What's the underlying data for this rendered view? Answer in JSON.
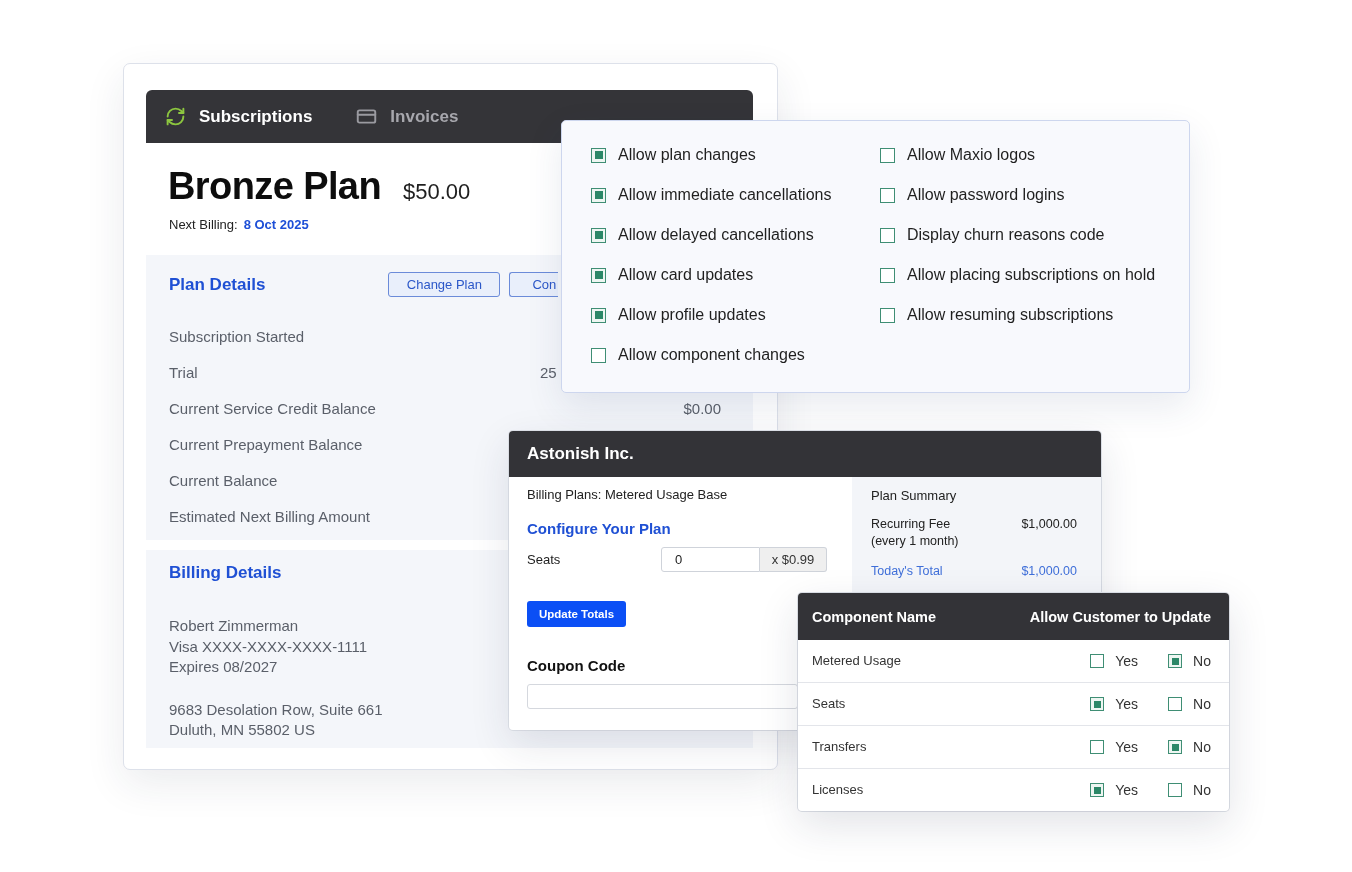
{
  "subscription_card": {
    "tabs": [
      {
        "label": "Subscriptions",
        "selected": true
      },
      {
        "label": "Invoices",
        "selected": false
      }
    ],
    "plan_name": "Bronze Plan",
    "price": "$50.00",
    "next_billing": {
      "label": "Next Billing:",
      "date": "8 Oct 2025"
    },
    "plan_details": {
      "title": "Plan Details",
      "buttons": [
        {
          "label": "Change Plan",
          "cut_off": false
        },
        {
          "label": "Con",
          "cut_off": true
        }
      ],
      "rows": [
        {
          "label": "Subscription Started"
        },
        {
          "label": "Trial",
          "value": "25",
          "cut_off": true
        },
        {
          "label": "Current Service Credit Balance",
          "value": "$0.00",
          "cut_off": false
        },
        {
          "label": "Current Prepayment Balance"
        },
        {
          "label": "Current Balance"
        },
        {
          "label": "Estimated Next Billing Amount"
        }
      ]
    },
    "billing_details": {
      "title": "Billing Details",
      "card_lines": [
        "Robert Zimmerman",
        "Visa XXXX-XXXX-XXXX-1111",
        "Expires 08/2027"
      ],
      "address_lines": [
        "9683 Desolation Row, Suite 661",
        "Duluth, MN 55802 US"
      ]
    }
  },
  "permissions_panel": {
    "columns": [
      {
        "options": [
          {
            "label": "Allow plan changes",
            "checked": true
          },
          {
            "label": "Allow immediate cancellations",
            "checked": true
          },
          {
            "label": "Allow delayed cancellations",
            "checked": true
          },
          {
            "label": "Allow card updates",
            "checked": true
          },
          {
            "label": "Allow profile updates",
            "checked": true
          },
          {
            "label": "Allow component changes",
            "checked": false
          }
        ]
      },
      {
        "options": [
          {
            "label": "Allow Maxio logos",
            "checked": false
          },
          {
            "label": "Allow password logins",
            "checked": false
          },
          {
            "label": "Display churn reasons code",
            "checked": false
          },
          {
            "label": "Allow placing subscriptions on hold",
            "checked": false
          },
          {
            "label": "Allow resuming subscriptions",
            "checked": false
          }
        ]
      }
    ]
  },
  "checkout_panel": {
    "title": "Astonish Inc.",
    "plan_label": "Billing Plans: Metered Usage Base",
    "configure_title": "Configure Your Plan",
    "seats": {
      "label": "Seats",
      "value": "0",
      "unit_price": "x $0.99"
    },
    "update_button": "Update Totals",
    "coupon_title": "Coupon Code",
    "summary": {
      "title": "Plan Summary",
      "lines": [
        {
          "kind": "fee",
          "label": "Recurring Fee",
          "note": "(every 1 month)",
          "amount": "$1,000.00"
        },
        {
          "kind": "total",
          "label": "Today's Total",
          "amount": "$1,000.00"
        }
      ]
    }
  },
  "component_table": {
    "columns": [
      "Component Name",
      "Allow Customer to Update"
    ],
    "rows": [
      {
        "name": "Metered Usage",
        "options": [
          {
            "label": "Yes",
            "checked": false
          },
          {
            "label": "No",
            "checked": true
          }
        ]
      },
      {
        "name": "Seats",
        "options": [
          {
            "label": "Yes",
            "checked": true
          },
          {
            "label": "No",
            "checked": false
          }
        ]
      },
      {
        "name": "Transfers",
        "options": [
          {
            "label": "Yes",
            "checked": false
          },
          {
            "label": "No",
            "checked": true
          }
        ]
      },
      {
        "name": "Licenses",
        "options": [
          {
            "label": "Yes",
            "checked": true
          },
          {
            "label": "No",
            "checked": false
          }
        ]
      }
    ]
  }
}
